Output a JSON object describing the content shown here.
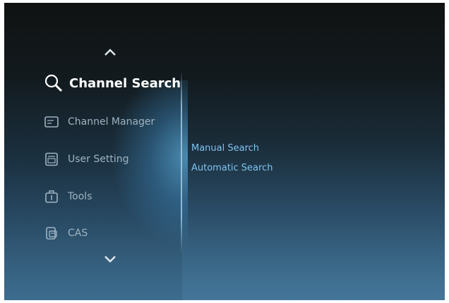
{
  "menu": {
    "items": [
      {
        "label": "Channel Search",
        "icon": "search-icon",
        "active": true
      },
      {
        "label": "Channel Manager",
        "icon": "channel-manager-icon",
        "active": false
      },
      {
        "label": "User Setting",
        "icon": "user-setting-icon",
        "active": false
      },
      {
        "label": "Tools",
        "icon": "tools-icon",
        "active": false
      },
      {
        "label": "CAS",
        "icon": "cas-icon",
        "active": false
      }
    ]
  },
  "submenu": {
    "items": [
      {
        "label": "Manual Search"
      },
      {
        "label": "Automatic Search"
      }
    ]
  },
  "colors": {
    "active_text": "#ffffff",
    "inactive_text": "#9fb3c1",
    "submenu_text": "#7ec3f0"
  }
}
